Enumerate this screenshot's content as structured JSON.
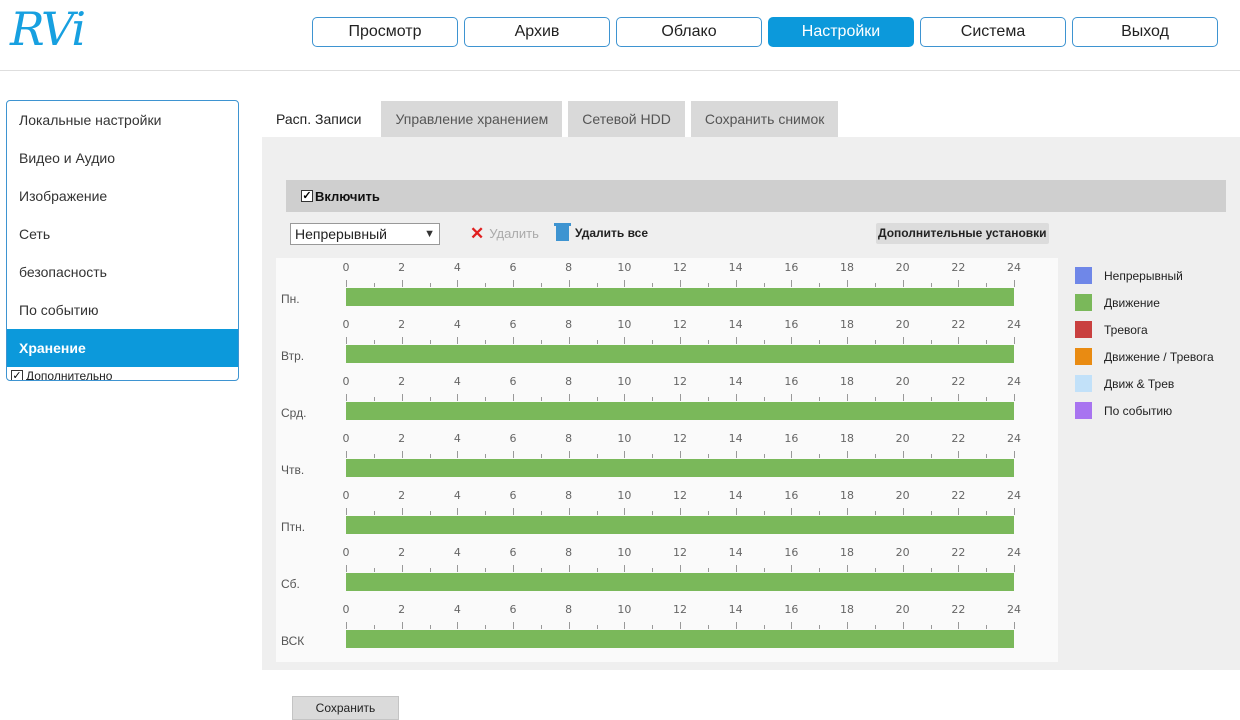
{
  "app": {
    "logo_text": "RVi"
  },
  "topnav": [
    "Просмотр",
    "Архив",
    "Облако",
    "Настройки",
    "Система",
    "Выход"
  ],
  "sidebar": {
    "items": [
      "Локальные настройки",
      "Видео и Аудио",
      "Изображение",
      "Сеть",
      "безопасность",
      "По событию",
      "Хранение"
    ],
    "extra_label": "Дополнительно"
  },
  "tabs": [
    "Расп. Записи",
    "Управление хранением",
    "Сетевой HDD",
    "Сохранить снимок"
  ],
  "enable": {
    "label": "Включить",
    "checked": true
  },
  "toolbar": {
    "mode_value": "Непрерывный",
    "delete_label": "Удалить",
    "delete_all_label": "Удалить все",
    "advanced_label": "Дополнительные установки"
  },
  "schedule": {
    "hour_labels": [
      "0",
      "2",
      "4",
      "6",
      "8",
      "10",
      "12",
      "14",
      "16",
      "18",
      "20",
      "22",
      "24"
    ],
    "days": [
      {
        "label": "Пн.",
        "type": "Движение"
      },
      {
        "label": "Втр.",
        "type": "Движение"
      },
      {
        "label": "Срд.",
        "type": "Движение"
      },
      {
        "label": "Чтв.",
        "type": "Движение"
      },
      {
        "label": "Птн.",
        "type": "Движение"
      },
      {
        "label": "Сб.",
        "type": "Движение"
      },
      {
        "label": "ВСК",
        "type": "Движение"
      }
    ]
  },
  "legend": [
    {
      "label": "Непрерывный",
      "color": "#6f87e8"
    },
    {
      "label": "Движение",
      "color": "#7ab85a"
    },
    {
      "label": "Тревога",
      "color": "#c9403f"
    },
    {
      "label": "Движение / Тревога",
      "color": "#e98b12"
    },
    {
      "label": "Движ & Трев",
      "color": "#c2e1f9"
    },
    {
      "label": "По событию",
      "color": "#a874f0"
    }
  ],
  "save_label": "Сохранить"
}
